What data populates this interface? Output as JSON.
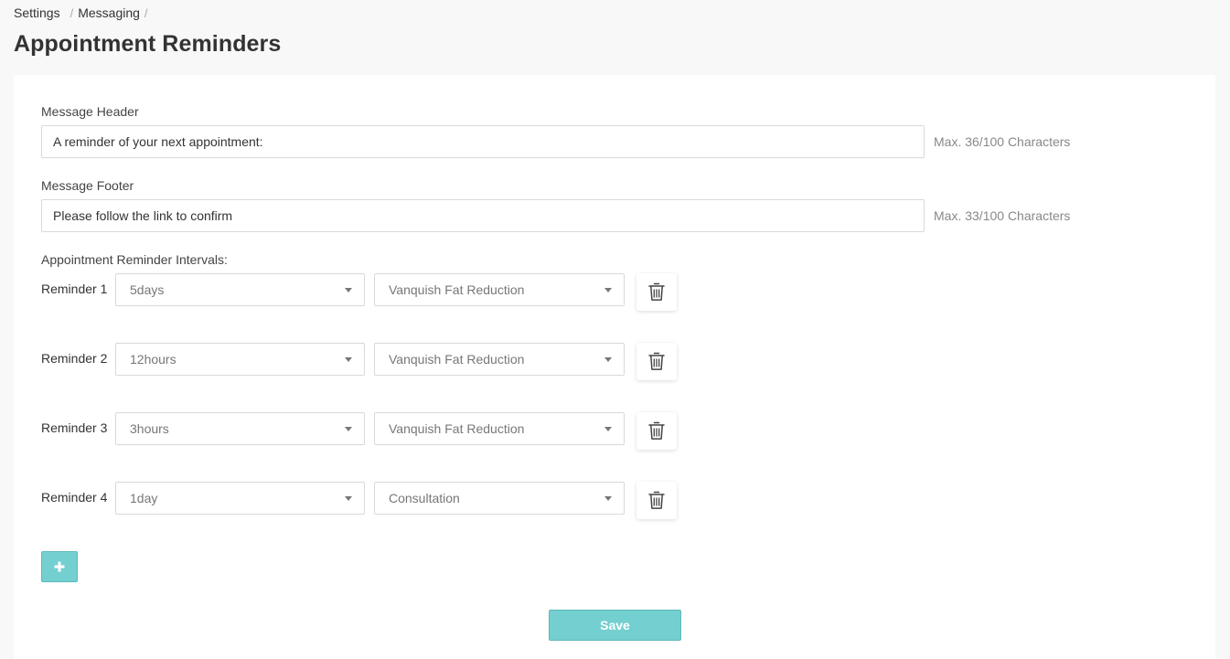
{
  "breadcrumb": {
    "items": [
      "Settings",
      "Messaging"
    ],
    "separator": "/"
  },
  "page": {
    "title": "Appointment Reminders"
  },
  "form": {
    "header": {
      "label": "Message Header",
      "value": "A reminder of your next appointment:",
      "count": "Max. 36/100 Characters"
    },
    "footer": {
      "label": "Message Footer",
      "value": "Please follow the link to confirm",
      "count": "Max. 33/100 Characters"
    },
    "intervals_label": "Appointment Reminder Intervals:",
    "reminders": [
      {
        "label": "Reminder 1",
        "time": "5days",
        "service": "Vanquish Fat Reduction"
      },
      {
        "label": "Reminder 2",
        "time": "12hours",
        "service": "Vanquish Fat Reduction"
      },
      {
        "label": "Reminder 3",
        "time": "3hours",
        "service": "Vanquish Fat Reduction"
      },
      {
        "label": "Reminder 4",
        "time": "1day",
        "service": "Consultation"
      }
    ],
    "add_icon": "plus-icon",
    "delete_icon": "trash-icon",
    "save_label": "Save"
  },
  "colors": {
    "accent": "#74cfd0",
    "accent_border": "#5fb8b9",
    "page_bg": "#f8f8f8",
    "card_bg": "#ffffff"
  }
}
